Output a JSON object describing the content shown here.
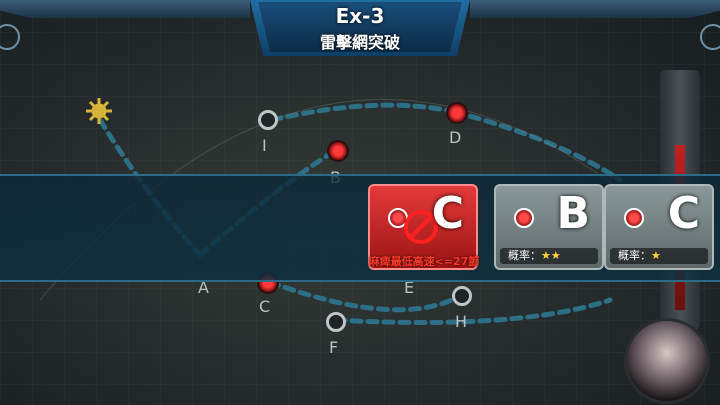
{
  "header": {
    "map_title": "Ex-3",
    "map_subtitle": "雷擊網突破"
  },
  "map": {
    "node_labels": {
      "I": "I",
      "D": "D",
      "B": "B",
      "A": "A",
      "C": "C",
      "E": "E",
      "F": "F",
      "H": "H"
    }
  },
  "route_choices": [
    {
      "node": "C",
      "status": "blocked",
      "caption": "麻痺最低高速<=27節"
    },
    {
      "node": "B",
      "probability_label": "概率：",
      "probability_stars": "★★",
      "star_count": 2
    },
    {
      "node": "C",
      "probability_label": "概率：",
      "probability_stars": "★",
      "star_count": 1
    }
  ],
  "gauge": {
    "fill_fraction": 0.75,
    "fill_color": "#c32020"
  },
  "colors": {
    "header_blue": "#1f6fa3",
    "route_dashed": "#2c6f86",
    "node_red": "#ff3a3a"
  }
}
